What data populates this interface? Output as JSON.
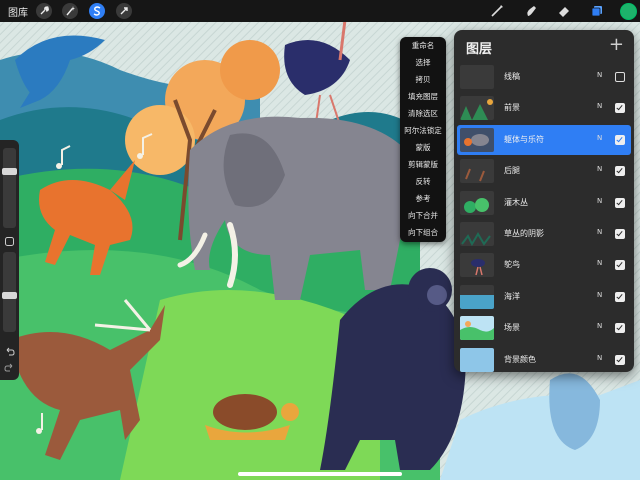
{
  "topbar": {
    "gallery_label": "图库",
    "tools": [
      {
        "name": "wrench-icon",
        "active": false
      },
      {
        "name": "magic-wand-icon",
        "active": false
      },
      {
        "name": "selection-s-icon",
        "active": true
      },
      {
        "name": "transform-arrow-icon",
        "active": false
      }
    ],
    "right_tools": [
      "brush-icon",
      "smudge-icon",
      "eraser-icon",
      "layers-icon"
    ],
    "current_color": "#1db36b",
    "accent_color": "#2f7ef4"
  },
  "context_menu": {
    "items": [
      "重命名",
      "选择",
      "拷贝",
      "填充图层",
      "清除选区",
      "阿尔法锁定",
      "蒙版",
      "剪辑蒙版",
      "反转",
      "参考",
      "向下合并",
      "向下组合"
    ]
  },
  "layers_panel": {
    "title": "图层",
    "add_icon": "plus-icon",
    "layers": [
      {
        "name": "线稿",
        "mode": "N",
        "visible": false,
        "active": false,
        "thumb": "lineart"
      },
      {
        "name": "前景",
        "mode": "N",
        "visible": true,
        "active": false,
        "thumb": "foreground"
      },
      {
        "name": "躯体与乐符",
        "mode": "N",
        "visible": true,
        "active": true,
        "thumb": "bodies"
      },
      {
        "name": "后腿",
        "mode": "N",
        "visible": true,
        "active": false,
        "thumb": "hindlegs"
      },
      {
        "name": "灌木丛",
        "mode": "N",
        "visible": true,
        "active": false,
        "thumb": "bushes"
      },
      {
        "name": "草丛的阴影",
        "mode": "N",
        "visible": true,
        "active": false,
        "thumb": "grass-shadow"
      },
      {
        "name": "鸵鸟",
        "mode": "N",
        "visible": true,
        "active": false,
        "thumb": "ostrich"
      },
      {
        "name": "海洋",
        "mode": "N",
        "visible": true,
        "active": false,
        "thumb": "ocean"
      },
      {
        "name": "场景",
        "mode": "N",
        "visible": true,
        "active": false,
        "thumb": "scene"
      },
      {
        "name": "背景颜色",
        "mode": "N",
        "visible": true,
        "active": false,
        "thumb": "bg-color"
      }
    ]
  },
  "sidebar": {
    "brush_size": 0.72,
    "opacity": 0.45
  }
}
